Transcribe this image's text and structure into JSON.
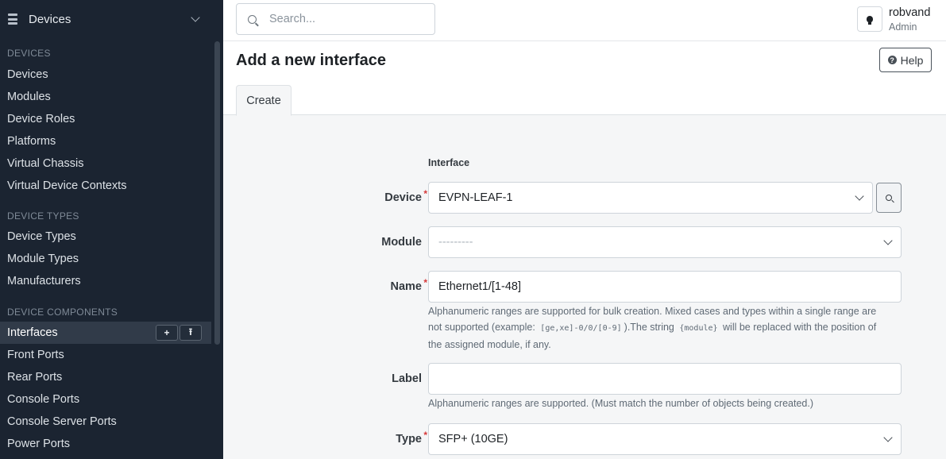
{
  "sidebar": {
    "menu_title": "Devices",
    "sections": [
      {
        "title": "DEVICES",
        "items": [
          "Devices",
          "Modules",
          "Device Roles",
          "Platforms",
          "Virtual Chassis",
          "Virtual Device Contexts"
        ]
      },
      {
        "title": "DEVICE TYPES",
        "items": [
          "Device Types",
          "Module Types",
          "Manufacturers"
        ]
      },
      {
        "title": "DEVICE COMPONENTS",
        "items": [
          "Interfaces",
          "Front Ports",
          "Rear Ports",
          "Console Ports",
          "Console Server Ports",
          "Power Ports"
        ]
      }
    ],
    "active_item": "Interfaces",
    "add_symbol": "+",
    "import_symbol": "⭱"
  },
  "topbar": {
    "search_placeholder": "Search...",
    "username": "robvand",
    "role": "Admin"
  },
  "page": {
    "title": "Add a new interface",
    "help_label": "Help",
    "tab_create": "Create"
  },
  "form": {
    "section_title": "Interface",
    "device": {
      "label": "Device",
      "value": "EVPN-LEAF-1"
    },
    "module": {
      "label": "Module",
      "value": "---------"
    },
    "name": {
      "label": "Name",
      "value": "Ethernet1/[1-48]",
      "help_1": "Alphanumeric ranges are supported for bulk creation. Mixed cases and types within a single range are",
      "help_2a": "not supported (example:",
      "help_code1": "[ge,xe]-0/0/[0-9]",
      "help_2b": ").The string",
      "help_code2": "{module}",
      "help_2c": "will be replaced with the position of",
      "help_3": "the assigned module, if any."
    },
    "label_field": {
      "label": "Label",
      "value": "",
      "help": "Alphanumeric ranges are supported. (Must match the number of objects being created.)"
    },
    "type": {
      "label": "Type",
      "value": "SFP+ (10GE)"
    }
  }
}
